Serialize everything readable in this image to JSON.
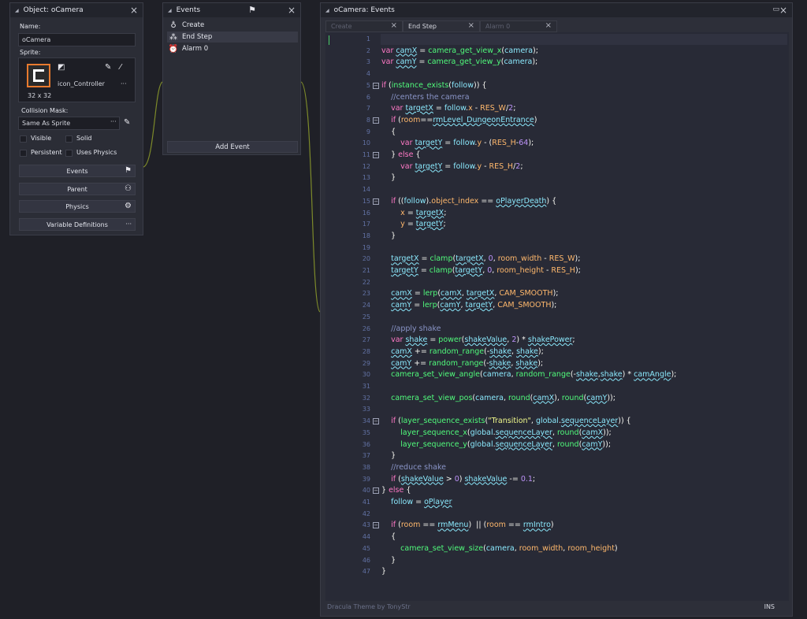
{
  "object_panel": {
    "title": "Object: oCamera",
    "name_label": "Name:",
    "name_value": "oCamera",
    "sprite_label": "Sprite:",
    "sprite_name": "icon_Controller",
    "sprite_size": "32 x 32",
    "collision_label": "Collision Mask:",
    "collision_value": "Same As Sprite",
    "visible": "Visible",
    "solid": "Solid",
    "persistent": "Persistent",
    "uses_physics": "Uses Physics",
    "buttons": [
      "Events",
      "Parent",
      "Physics",
      "Variable Definitions"
    ],
    "dots": "···"
  },
  "events_panel": {
    "title": "Events",
    "items": [
      "Create",
      "End Step",
      "Alarm 0"
    ],
    "add_event": "Add Event"
  },
  "code_panel": {
    "title": "oCamera: Events",
    "tabs": [
      "Create",
      "End Step",
      "Alarm 0"
    ],
    "status_left": "Dracula Theme by TonyStr",
    "status_right": "INS",
    "line_numbers": [
      "1",
      "2",
      "3",
      "4",
      "5",
      "6",
      "7",
      "8",
      "9",
      "10",
      "11",
      "12",
      "13",
      "14",
      "15",
      "16",
      "17",
      "18",
      "19",
      "20",
      "21",
      "22",
      "23",
      "24",
      "25",
      "26",
      "27",
      "28",
      "29",
      "30",
      "31",
      "32",
      "33",
      "34",
      "35",
      "36",
      "37",
      "38",
      "39",
      "40",
      "41",
      "42",
      "43",
      "44",
      "45",
      "46",
      "47"
    ],
    "code": [
      "",
      "var camX = camera_get_view_x(camera);",
      "var camY = camera_get_view_y(camera);",
      "",
      "if (instance_exists(follow)) {",
      "    //centers the camera",
      "    var targetX = follow.x - RES_W/2;",
      "    if (room==rmLevel_DungeonEntrance)",
      "    {",
      "        var targetY = follow.y - (RES_H-64);",
      "    } else {",
      "        var targetY = follow.y - RES_H/2;",
      "    }",
      "",
      "    if ((follow).object_index == oPlayerDeath) {",
      "        x = targetX;",
      "        y = targetY;",
      "    }",
      "",
      "    targetX = clamp(targetX, 0, room_width - RES_W);",
      "    targetY = clamp(targetY, 0, room_height - RES_H);",
      "",
      "    camX = lerp(camX, targetX, CAM_SMOOTH);",
      "    camY = lerp(camY, targetY, CAM_SMOOTH);",
      "",
      "    //apply shake",
      "    var shake = power(shakeValue, 2) * shakePower;",
      "    camX += random_range(-shake, shake);",
      "    camY += random_range(-shake, shake);",
      "    camera_set_view_angle(camera, random_range(-shake,shake) * camAngle);",
      "",
      "    camera_set_view_pos(camera, round(camX), round(camY));",
      "",
      "    if (layer_sequence_exists(\"Transition\", global.sequenceLayer)) {",
      "        layer_sequence_x(global.sequenceLayer, round(camX));",
      "        layer_sequence_y(global.sequenceLayer, round(camY));",
      "    }",
      "    //reduce shake",
      "    if (shakeValue > 0) shakeValue -= 0.1;",
      "} else {",
      "    follow = oPlayer",
      "",
      "    if (room == rmMenu)  || (room == rmIntro)",
      "    {",
      "        camera_set_view_size(camera, room_width, room_height)",
      "    }",
      "}"
    ]
  }
}
